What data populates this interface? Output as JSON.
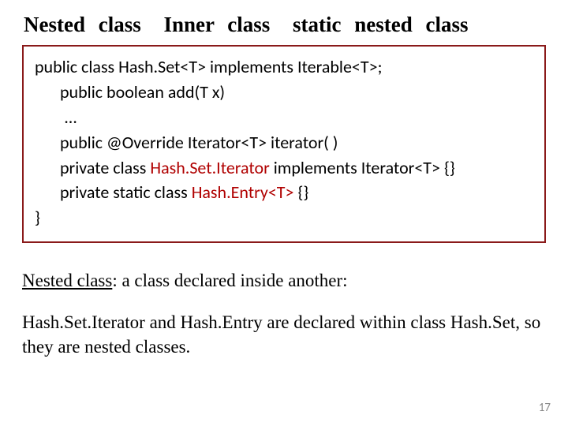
{
  "title": {
    "part1": "Nested class",
    "part2": "Inner class",
    "part3": "static nested class"
  },
  "code": {
    "line1": "public class Hash.Set<T>  implements Iterable<T>;",
    "line2": "public boolean add(T x)",
    "line3": " …",
    "line4": "public @Override Iterator<T> iterator( )",
    "line5a": "private class ",
    "line5b": "Hash.Set.Iterator",
    "line5c": " implements Iterator<T> {}",
    "line6a": "private static class ",
    "line6b": "Hash.Entry<T>",
    "line6c": " {}",
    "line7": "}"
  },
  "body": {
    "p1_u": "Nested class",
    "p1_rest": ": a class declared inside another:",
    "p2": "Hash.Set.Iterator and Hash.Entry are declared within class Hash.Set, so they are nested classes."
  },
  "page": "17"
}
